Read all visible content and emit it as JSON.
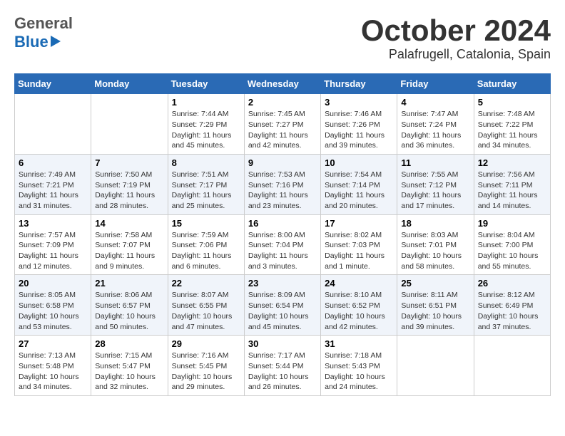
{
  "header": {
    "logo_general": "General",
    "logo_blue": "Blue",
    "month_title": "October 2024",
    "location": "Palafrugell, Catalonia, Spain"
  },
  "calendar": {
    "headers": [
      "Sunday",
      "Monday",
      "Tuesday",
      "Wednesday",
      "Thursday",
      "Friday",
      "Saturday"
    ],
    "weeks": [
      [
        {
          "day": "",
          "sunrise": "",
          "sunset": "",
          "daylight": ""
        },
        {
          "day": "",
          "sunrise": "",
          "sunset": "",
          "daylight": ""
        },
        {
          "day": "1",
          "sunrise": "Sunrise: 7:44 AM",
          "sunset": "Sunset: 7:29 PM",
          "daylight": "Daylight: 11 hours and 45 minutes."
        },
        {
          "day": "2",
          "sunrise": "Sunrise: 7:45 AM",
          "sunset": "Sunset: 7:27 PM",
          "daylight": "Daylight: 11 hours and 42 minutes."
        },
        {
          "day": "3",
          "sunrise": "Sunrise: 7:46 AM",
          "sunset": "Sunset: 7:26 PM",
          "daylight": "Daylight: 11 hours and 39 minutes."
        },
        {
          "day": "4",
          "sunrise": "Sunrise: 7:47 AM",
          "sunset": "Sunset: 7:24 PM",
          "daylight": "Daylight: 11 hours and 36 minutes."
        },
        {
          "day": "5",
          "sunrise": "Sunrise: 7:48 AM",
          "sunset": "Sunset: 7:22 PM",
          "daylight": "Daylight: 11 hours and 34 minutes."
        }
      ],
      [
        {
          "day": "6",
          "sunrise": "Sunrise: 7:49 AM",
          "sunset": "Sunset: 7:21 PM",
          "daylight": "Daylight: 11 hours and 31 minutes."
        },
        {
          "day": "7",
          "sunrise": "Sunrise: 7:50 AM",
          "sunset": "Sunset: 7:19 PM",
          "daylight": "Daylight: 11 hours and 28 minutes."
        },
        {
          "day": "8",
          "sunrise": "Sunrise: 7:51 AM",
          "sunset": "Sunset: 7:17 PM",
          "daylight": "Daylight: 11 hours and 25 minutes."
        },
        {
          "day": "9",
          "sunrise": "Sunrise: 7:53 AM",
          "sunset": "Sunset: 7:16 PM",
          "daylight": "Daylight: 11 hours and 23 minutes."
        },
        {
          "day": "10",
          "sunrise": "Sunrise: 7:54 AM",
          "sunset": "Sunset: 7:14 PM",
          "daylight": "Daylight: 11 hours and 20 minutes."
        },
        {
          "day": "11",
          "sunrise": "Sunrise: 7:55 AM",
          "sunset": "Sunset: 7:12 PM",
          "daylight": "Daylight: 11 hours and 17 minutes."
        },
        {
          "day": "12",
          "sunrise": "Sunrise: 7:56 AM",
          "sunset": "Sunset: 7:11 PM",
          "daylight": "Daylight: 11 hours and 14 minutes."
        }
      ],
      [
        {
          "day": "13",
          "sunrise": "Sunrise: 7:57 AM",
          "sunset": "Sunset: 7:09 PM",
          "daylight": "Daylight: 11 hours and 12 minutes."
        },
        {
          "day": "14",
          "sunrise": "Sunrise: 7:58 AM",
          "sunset": "Sunset: 7:07 PM",
          "daylight": "Daylight: 11 hours and 9 minutes."
        },
        {
          "day": "15",
          "sunrise": "Sunrise: 7:59 AM",
          "sunset": "Sunset: 7:06 PM",
          "daylight": "Daylight: 11 hours and 6 minutes."
        },
        {
          "day": "16",
          "sunrise": "Sunrise: 8:00 AM",
          "sunset": "Sunset: 7:04 PM",
          "daylight": "Daylight: 11 hours and 3 minutes."
        },
        {
          "day": "17",
          "sunrise": "Sunrise: 8:02 AM",
          "sunset": "Sunset: 7:03 PM",
          "daylight": "Daylight: 11 hours and 1 minute."
        },
        {
          "day": "18",
          "sunrise": "Sunrise: 8:03 AM",
          "sunset": "Sunset: 7:01 PM",
          "daylight": "Daylight: 10 hours and 58 minutes."
        },
        {
          "day": "19",
          "sunrise": "Sunrise: 8:04 AM",
          "sunset": "Sunset: 7:00 PM",
          "daylight": "Daylight: 10 hours and 55 minutes."
        }
      ],
      [
        {
          "day": "20",
          "sunrise": "Sunrise: 8:05 AM",
          "sunset": "Sunset: 6:58 PM",
          "daylight": "Daylight: 10 hours and 53 minutes."
        },
        {
          "day": "21",
          "sunrise": "Sunrise: 8:06 AM",
          "sunset": "Sunset: 6:57 PM",
          "daylight": "Daylight: 10 hours and 50 minutes."
        },
        {
          "day": "22",
          "sunrise": "Sunrise: 8:07 AM",
          "sunset": "Sunset: 6:55 PM",
          "daylight": "Daylight: 10 hours and 47 minutes."
        },
        {
          "day": "23",
          "sunrise": "Sunrise: 8:09 AM",
          "sunset": "Sunset: 6:54 PM",
          "daylight": "Daylight: 10 hours and 45 minutes."
        },
        {
          "day": "24",
          "sunrise": "Sunrise: 8:10 AM",
          "sunset": "Sunset: 6:52 PM",
          "daylight": "Daylight: 10 hours and 42 minutes."
        },
        {
          "day": "25",
          "sunrise": "Sunrise: 8:11 AM",
          "sunset": "Sunset: 6:51 PM",
          "daylight": "Daylight: 10 hours and 39 minutes."
        },
        {
          "day": "26",
          "sunrise": "Sunrise: 8:12 AM",
          "sunset": "Sunset: 6:49 PM",
          "daylight": "Daylight: 10 hours and 37 minutes."
        }
      ],
      [
        {
          "day": "27",
          "sunrise": "Sunrise: 7:13 AM",
          "sunset": "Sunset: 5:48 PM",
          "daylight": "Daylight: 10 hours and 34 minutes."
        },
        {
          "day": "28",
          "sunrise": "Sunrise: 7:15 AM",
          "sunset": "Sunset: 5:47 PM",
          "daylight": "Daylight: 10 hours and 32 minutes."
        },
        {
          "day": "29",
          "sunrise": "Sunrise: 7:16 AM",
          "sunset": "Sunset: 5:45 PM",
          "daylight": "Daylight: 10 hours and 29 minutes."
        },
        {
          "day": "30",
          "sunrise": "Sunrise: 7:17 AM",
          "sunset": "Sunset: 5:44 PM",
          "daylight": "Daylight: 10 hours and 26 minutes."
        },
        {
          "day": "31",
          "sunrise": "Sunrise: 7:18 AM",
          "sunset": "Sunset: 5:43 PM",
          "daylight": "Daylight: 10 hours and 24 minutes."
        },
        {
          "day": "",
          "sunrise": "",
          "sunset": "",
          "daylight": ""
        },
        {
          "day": "",
          "sunrise": "",
          "sunset": "",
          "daylight": ""
        }
      ]
    ]
  }
}
